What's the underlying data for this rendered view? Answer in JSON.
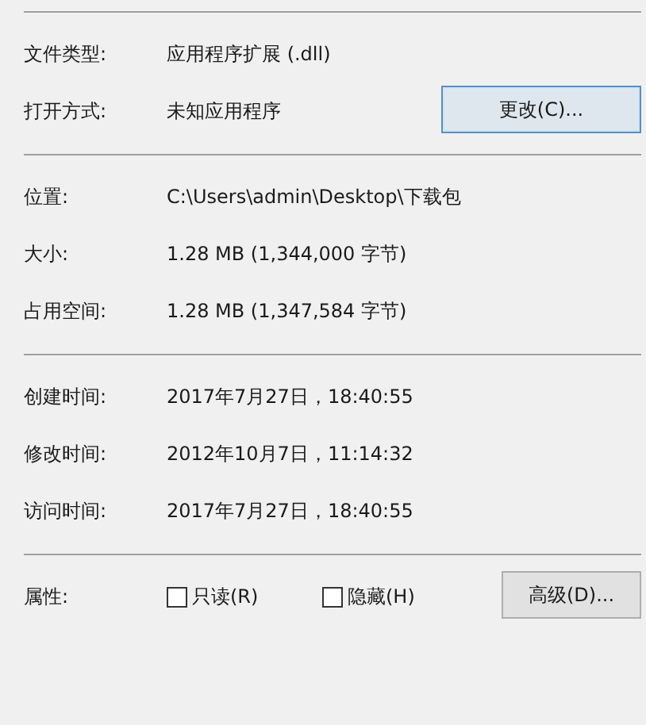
{
  "sections": [
    {
      "rows": [
        {
          "label": "文件类型:",
          "value": "应用程序扩展 (.dll)"
        },
        {
          "label": "打开方式:",
          "value": "未知应用程序",
          "button": {
            "label": "更改(C)...",
            "focused": true
          }
        }
      ]
    },
    {
      "rows": [
        {
          "label": "位置:",
          "value": "C:\\Users\\admin\\Desktop\\下载包"
        },
        {
          "label": "大小:",
          "value": "1.28 MB (1,344,000 字节)"
        },
        {
          "label": "占用空间:",
          "value": "1.28 MB (1,347,584 字节)"
        }
      ]
    },
    {
      "rows": [
        {
          "label": "创建时间:",
          "value": "2017年7月27日，18:40:55"
        },
        {
          "label": "修改时间:",
          "value": "2012年10月7日，11:14:32"
        },
        {
          "label": "访问时间:",
          "value": "2017年7月27日，18:40:55"
        }
      ]
    }
  ],
  "attributes": {
    "label": "属性:",
    "checkboxes": [
      {
        "label": "只读(R)",
        "checked": false
      },
      {
        "label": "隐藏(H)",
        "checked": false
      }
    ],
    "button": {
      "label": "高级(D)...",
      "focused": false
    }
  }
}
